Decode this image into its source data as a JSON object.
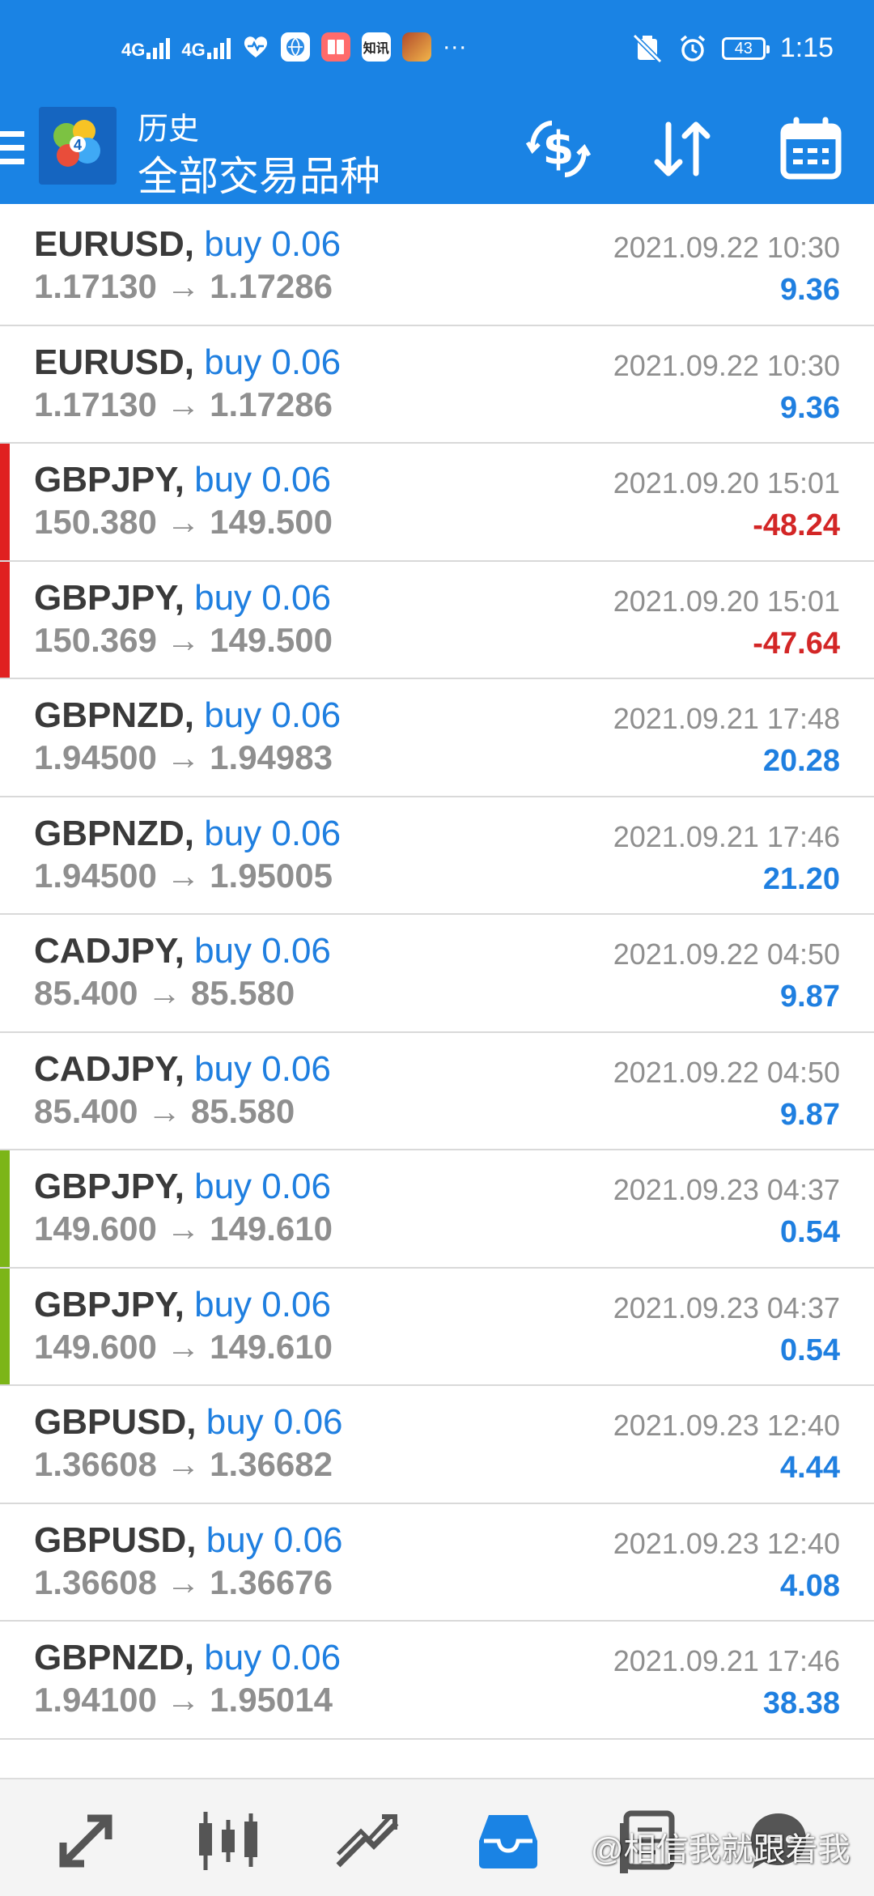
{
  "status_bar": {
    "sim1": "4G",
    "sim2": "4G",
    "zhixun_label": "知讯",
    "battery": "43",
    "time": "1:15",
    "more": "···"
  },
  "app_bar": {
    "title": "历史",
    "subtitle": "全部交易品种"
  },
  "colors": {
    "header": "#1a83e4",
    "profit_positive": "#1f7fe0",
    "profit_negative": "#d32626",
    "marker_red": "#e02020",
    "marker_green": "#7cb518",
    "active_nav": "#1a83e4"
  },
  "trades": [
    {
      "symbol": "EURUSD,",
      "side": "buy 0.06",
      "open": "1.17130",
      "close": "1.17286",
      "time": "2021.09.22 10:30",
      "profit": "9.36",
      "profit_sign": "positive",
      "marker": "none"
    },
    {
      "symbol": "EURUSD,",
      "side": "buy 0.06",
      "open": "1.17130",
      "close": "1.17286",
      "time": "2021.09.22 10:30",
      "profit": "9.36",
      "profit_sign": "positive",
      "marker": "none"
    },
    {
      "symbol": "GBPJPY,",
      "side": "buy 0.06",
      "open": "150.380",
      "close": "149.500",
      "time": "2021.09.20 15:01",
      "profit": "-48.24",
      "profit_sign": "negative",
      "marker": "red"
    },
    {
      "symbol": "GBPJPY,",
      "side": "buy 0.06",
      "open": "150.369",
      "close": "149.500",
      "time": "2021.09.20 15:01",
      "profit": "-47.64",
      "profit_sign": "negative",
      "marker": "red"
    },
    {
      "symbol": "GBPNZD,",
      "side": "buy 0.06",
      "open": "1.94500",
      "close": "1.94983",
      "time": "2021.09.21 17:48",
      "profit": "20.28",
      "profit_sign": "positive",
      "marker": "none"
    },
    {
      "symbol": "GBPNZD,",
      "side": "buy 0.06",
      "open": "1.94500",
      "close": "1.95005",
      "time": "2021.09.21 17:46",
      "profit": "21.20",
      "profit_sign": "positive",
      "marker": "none"
    },
    {
      "symbol": "CADJPY,",
      "side": "buy 0.06",
      "open": "85.400",
      "close": "85.580",
      "time": "2021.09.22 04:50",
      "profit": "9.87",
      "profit_sign": "positive",
      "marker": "none"
    },
    {
      "symbol": "CADJPY,",
      "side": "buy 0.06",
      "open": "85.400",
      "close": "85.580",
      "time": "2021.09.22 04:50",
      "profit": "9.87",
      "profit_sign": "positive",
      "marker": "none"
    },
    {
      "symbol": "GBPJPY,",
      "side": "buy 0.06",
      "open": "149.600",
      "close": "149.610",
      "time": "2021.09.23 04:37",
      "profit": "0.54",
      "profit_sign": "positive",
      "marker": "green"
    },
    {
      "symbol": "GBPJPY,",
      "side": "buy 0.06",
      "open": "149.600",
      "close": "149.610",
      "time": "2021.09.23 04:37",
      "profit": "0.54",
      "profit_sign": "positive",
      "marker": "green"
    },
    {
      "symbol": "GBPUSD,",
      "side": "buy 0.06",
      "open": "1.36608",
      "close": "1.36682",
      "time": "2021.09.23 12:40",
      "profit": "4.44",
      "profit_sign": "positive",
      "marker": "none"
    },
    {
      "symbol": "GBPUSD,",
      "side": "buy 0.06",
      "open": "1.36608",
      "close": "1.36676",
      "time": "2021.09.23 12:40",
      "profit": "4.08",
      "profit_sign": "positive",
      "marker": "none"
    },
    {
      "symbol": "GBPNZD,",
      "side": "buy 0.06",
      "open": "1.94100",
      "close": "1.95014",
      "time": "2021.09.21 17:46",
      "profit": "38.38",
      "profit_sign": "positive",
      "marker": "none"
    }
  ],
  "arrow": "→",
  "bottom_nav": {
    "items": [
      {
        "icon": "quotes-arrows-icon"
      },
      {
        "icon": "candlestick-chart-icon"
      },
      {
        "icon": "trend-line-icon"
      },
      {
        "icon": "inbox-tray-icon",
        "active": true
      },
      {
        "icon": "journal-icon"
      },
      {
        "icon": "chat-bubble-icon"
      }
    ]
  },
  "watermark": "@相信我就跟着我"
}
